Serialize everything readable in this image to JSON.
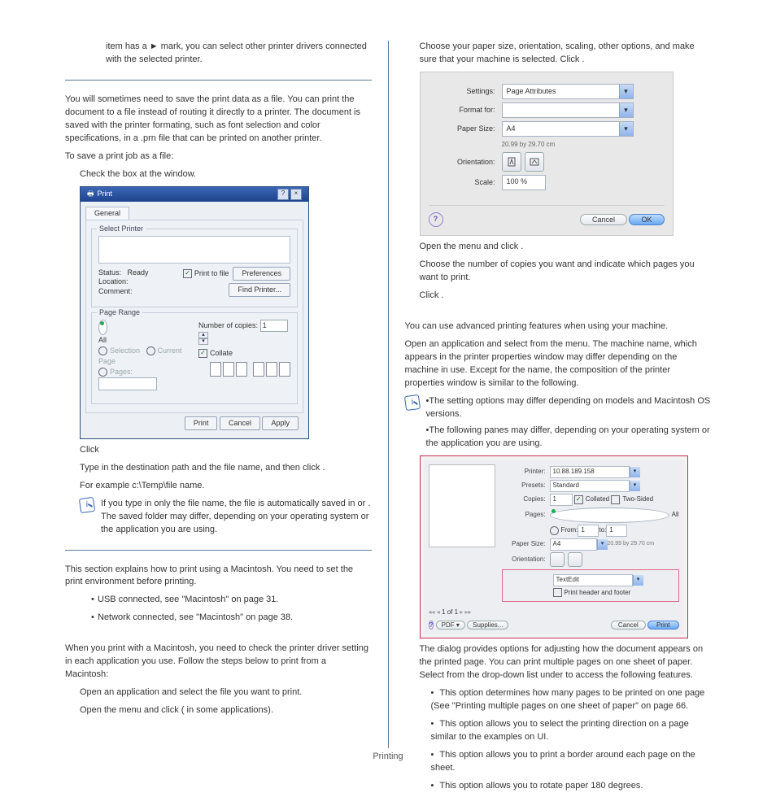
{
  "footer": "Printing",
  "left": {
    "p1a": "item has a ► mark, you can select other printer drivers connected with the selected printer.",
    "p2": "You will sometimes need to save the print data as a file. You can print the document to a file instead of routing it directly to a printer. The document is saved with the printer formating, such as font selection and color specifications, in a .prn file that can be printed on another printer.",
    "p3": "To save a print job as a file:",
    "p4a": "Check the ",
    "p4b": " box at the ",
    "p4c": " window.",
    "dialog": {
      "title": "Print",
      "tab": "General",
      "grp1": "Select Printer",
      "status_l": "Status:",
      "status_v": "Ready",
      "loc_l": "Location:",
      "com_l": "Comment:",
      "ptf": "Print to file",
      "pref": "Preferences",
      "find": "Find Printer...",
      "grp2": "Page Range",
      "all": "All",
      "sel": "Selection",
      "cur": "Current Page",
      "pages": "Pages:",
      "copies_l": "Number of copies:",
      "copies_v": "1",
      "collate": "Collate",
      "print": "Print",
      "cancel": "Cancel",
      "apply": "Apply"
    },
    "p5": "Click ",
    "p6a": "Type in the destination path and the file name, and then click ",
    "p6b": ".",
    "p7": "For example c:\\Temp\\file name.",
    "note1a": "If you type in only the file name, the file is automatically saved in ",
    "note1b": " or ",
    "note1c": ". The saved folder may differ, depending on your operating system or the application you are using.",
    "p8": "This section explains how to print using a Macintosh. You need to set the print environment before printing.",
    "b1": "USB connected, see \"Macintosh\" on page 31.",
    "b2": "Network connected, see \"Macintosh\" on page 38.",
    "p9": "When you print with a Macintosh, you need to check the printer driver setting in each application you use. Follow the steps below to print from a Macintosh:",
    "s1": "Open an application and select the file you want to print.",
    "s2a": "Open the ",
    "s2b": " menu and click ",
    "s2c": " (",
    "s2d": " in some applications)."
  },
  "right": {
    "p1": "Choose your paper size, orientation, scaling, other options, and make sure that your machine is selected. Click ",
    "p1b": ".",
    "panel": {
      "settings_l": "Settings:",
      "settings_v": "Page Attributes",
      "format_l": "Format for:",
      "size_l": "Paper Size:",
      "size_v": "A4",
      "size_sub": "20.99 by 29.70 cm",
      "orient_l": "Orientation:",
      "scale_l": "Scale:",
      "scale_v": "100 %",
      "cancel": "Cancel",
      "ok": "OK"
    },
    "p2a": "Open the ",
    "p2b": " menu and click ",
    "p2c": ".",
    "p3": "Choose the number of copies you want and indicate which pages you want to print.",
    "p4": "Click ",
    "p4b": ".",
    "p5": "You can use advanced printing features when using your machine.",
    "p6a": "Open an application and select ",
    "p6b": " from the ",
    "p6c": " menu. The machine name, which appears in the printer properties window may differ depending on the machine in use. Except for the name, the composition of the printer properties window is similar to the following.",
    "n1": "The setting options may differ depending on models and Macintosh OS versions.",
    "n2": "The following panes may differ, depending on your operating system or the application you are using.",
    "ss2": {
      "printer_l": "Printer:",
      "printer_v": "10.88.189.158",
      "presets_l": "Presets:",
      "presets_v": "Standard",
      "copies_l": "Copies:",
      "copies_v": "1",
      "collated": "Collated",
      "two": "Two-Sided",
      "pages_l": "Pages:",
      "all": "All",
      "from": "From:",
      "from_v": "1",
      "to": "to:",
      "to_v": "1",
      "psize_l": "Paper Size:",
      "psize_v": "A4",
      "psize_sub": "20.99 by 29.70 cm",
      "orient_l": "Orientation:",
      "textedit": "TextEdit",
      "phf": "Print header and footer",
      "nav": "1 of 1",
      "pdf": "PDF ▾",
      "supplies": "Supplies...",
      "cancel": "Cancel",
      "print": "Print"
    },
    "p7a": "The ",
    "p7b": " dialog provides options for adjusting how the document appears on the printed page. You can print multiple pages on one sheet of paper. Select ",
    "p7c": " from the drop-down list under ",
    "p7d": " to access the following features.",
    "f1a": " This option determines how many pages to be printed on one page (See \"Printing multiple pages on one sheet of paper\" on page 66.",
    "f2a": " This option allows you to select the printing direction on a page similar to the examples on UI.",
    "f3a": " This option allows you to print a border around each page on the sheet.",
    "f4a": " This option allows you to rotate paper 180 degrees."
  }
}
